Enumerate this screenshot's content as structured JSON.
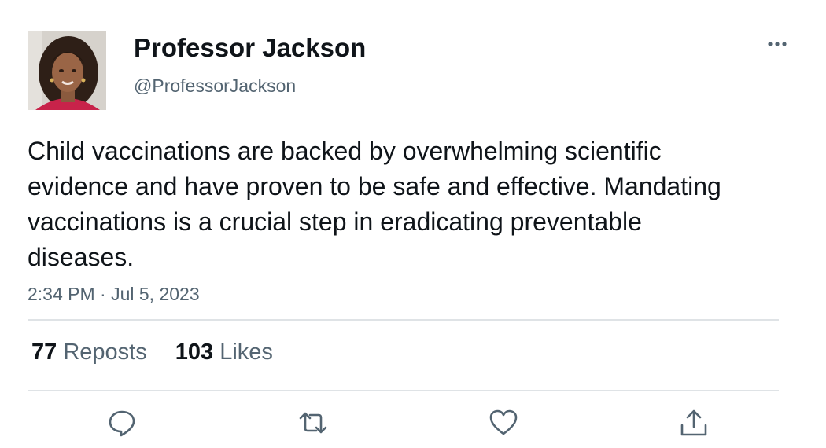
{
  "author": {
    "display_name": "Professor Jackson",
    "handle": "@ProfessorJackson",
    "avatar_icon": "profile-photo"
  },
  "tweet": {
    "text": "Child vaccinations are backed by overwhelming scientific evidence and have proven to be safe and effective. Mandating vaccinations is a crucial step in eradicating preventable diseases.",
    "timestamp": "2:34 PM · Jul 5, 2023"
  },
  "stats": {
    "reposts_count": "77",
    "reposts_label": "Reposts",
    "likes_count": "103",
    "likes_label": "Likes"
  },
  "actions": {
    "more": "more-options-icon",
    "reply": "reply-icon",
    "repost": "repost-icon",
    "like": "heart-icon",
    "share": "share-icon"
  },
  "colors": {
    "text_primary": "#0f1419",
    "text_secondary": "#536471",
    "divider": "#dfe3e6"
  }
}
